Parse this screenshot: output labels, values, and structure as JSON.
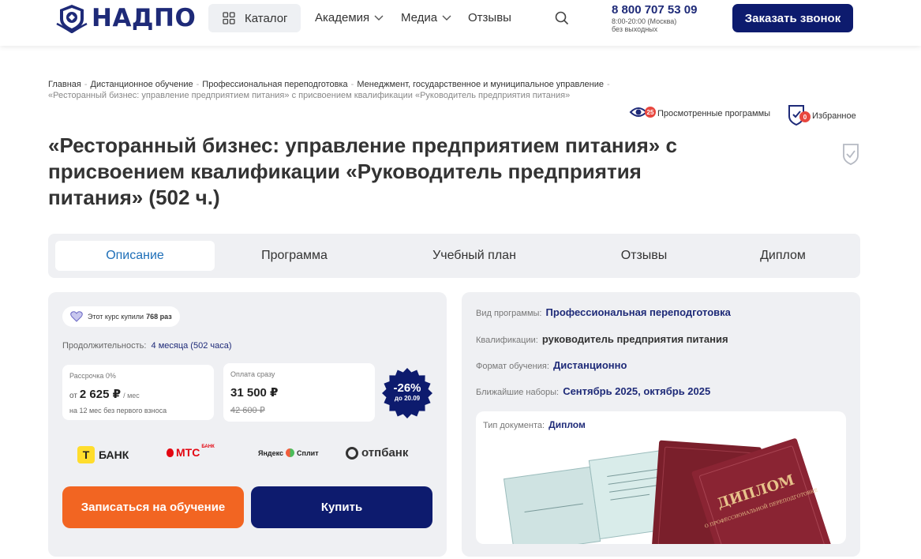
{
  "header": {
    "logo_text": "НАДПО",
    "catalog_label": "Каталог",
    "nav": [
      {
        "label": "Академия",
        "has_dropdown": true
      },
      {
        "label": "Медиа",
        "has_dropdown": true
      },
      {
        "label": "Отзывы",
        "has_dropdown": false
      }
    ],
    "phone": "8 800 707 53 09",
    "hours_line1": "8:00-20:00 (Москва)",
    "hours_line2": "без выходных",
    "call_button": "Заказать звонок",
    "accent": "#0d1b6e"
  },
  "breadcrumb": {
    "items": [
      "Главная",
      "Дистанционное обучение",
      "Профессиональная переподготовка",
      "Менеджмент, государственное и муниципальное управление"
    ],
    "separator": "-",
    "current": "«Ресторанный бизнес: управление предприятием питания» с присвоением квалификации «Руководитель предприятия питания»"
  },
  "utilities": {
    "viewed_label": "Просмотренные программы",
    "viewed_count": "25",
    "favorites_label": "Избранное",
    "favorites_count": "0"
  },
  "page_title": "«Ресторанный бизнес: управление предприятием питания» с присвоением квалификации «Руководитель предприятия питания» (502 ч.)",
  "tabs": [
    {
      "label": "Описание",
      "active": true
    },
    {
      "label": "Программа",
      "active": false
    },
    {
      "label": "Учебный план",
      "active": false
    },
    {
      "label": "Отзывы",
      "active": false
    },
    {
      "label": "Диплом",
      "active": false
    }
  ],
  "purchase": {
    "bought_prefix": "Этот курс купили",
    "bought_count": "768 раз",
    "duration_label": "Продолжительность:",
    "duration_value": "4 месяца (502 часа)",
    "installment": {
      "label": "Рассрочка 0%",
      "prefix": "от",
      "amount": "2 625 ₽",
      "suffix": "/ мес",
      "note": "на 12 мес без первого взноса"
    },
    "full_payment": {
      "label": "Оплата сразу",
      "amount": "31 500 ₽",
      "old_amount": "42 600 ₽"
    },
    "discount": {
      "percent": "-26%",
      "until": "до 20.09",
      "color": "#0d1b6e"
    },
    "banks": [
      {
        "name": "Т-Банк",
        "text": "БАНК",
        "mark": "Т"
      },
      {
        "name": "МТС Банк",
        "text": "МТС",
        "sub": "БАНК"
      },
      {
        "name": "Яндекс Сплит",
        "text": "Яндекс",
        "sub": "Сплит"
      },
      {
        "name": "ОТП Банк",
        "text": "отпбанк"
      }
    ],
    "enroll_button": "Записаться на обучение",
    "buy_button": "Купить",
    "enroll_color": "#f26522"
  },
  "program_info": {
    "rows": [
      {
        "label": "Вид программы:",
        "value": "Профессиональная переподготовка"
      },
      {
        "label": "Квалификации:",
        "value": "руководитель предприятия питания"
      },
      {
        "label": "Формат обучения:",
        "value": "Дистанционно"
      },
      {
        "label": "Ближайшие наборы:",
        "value": "Сентябрь 2025, октябрь 2025"
      }
    ],
    "document_label": "Тип документа:",
    "document_value": "Диплом",
    "diploma_cover_text": "ДИПЛОМ",
    "diploma_sub": "О ПРОФЕССИОНАЛЬНОЙ ПЕРЕПОДГОТОВКЕ"
  }
}
